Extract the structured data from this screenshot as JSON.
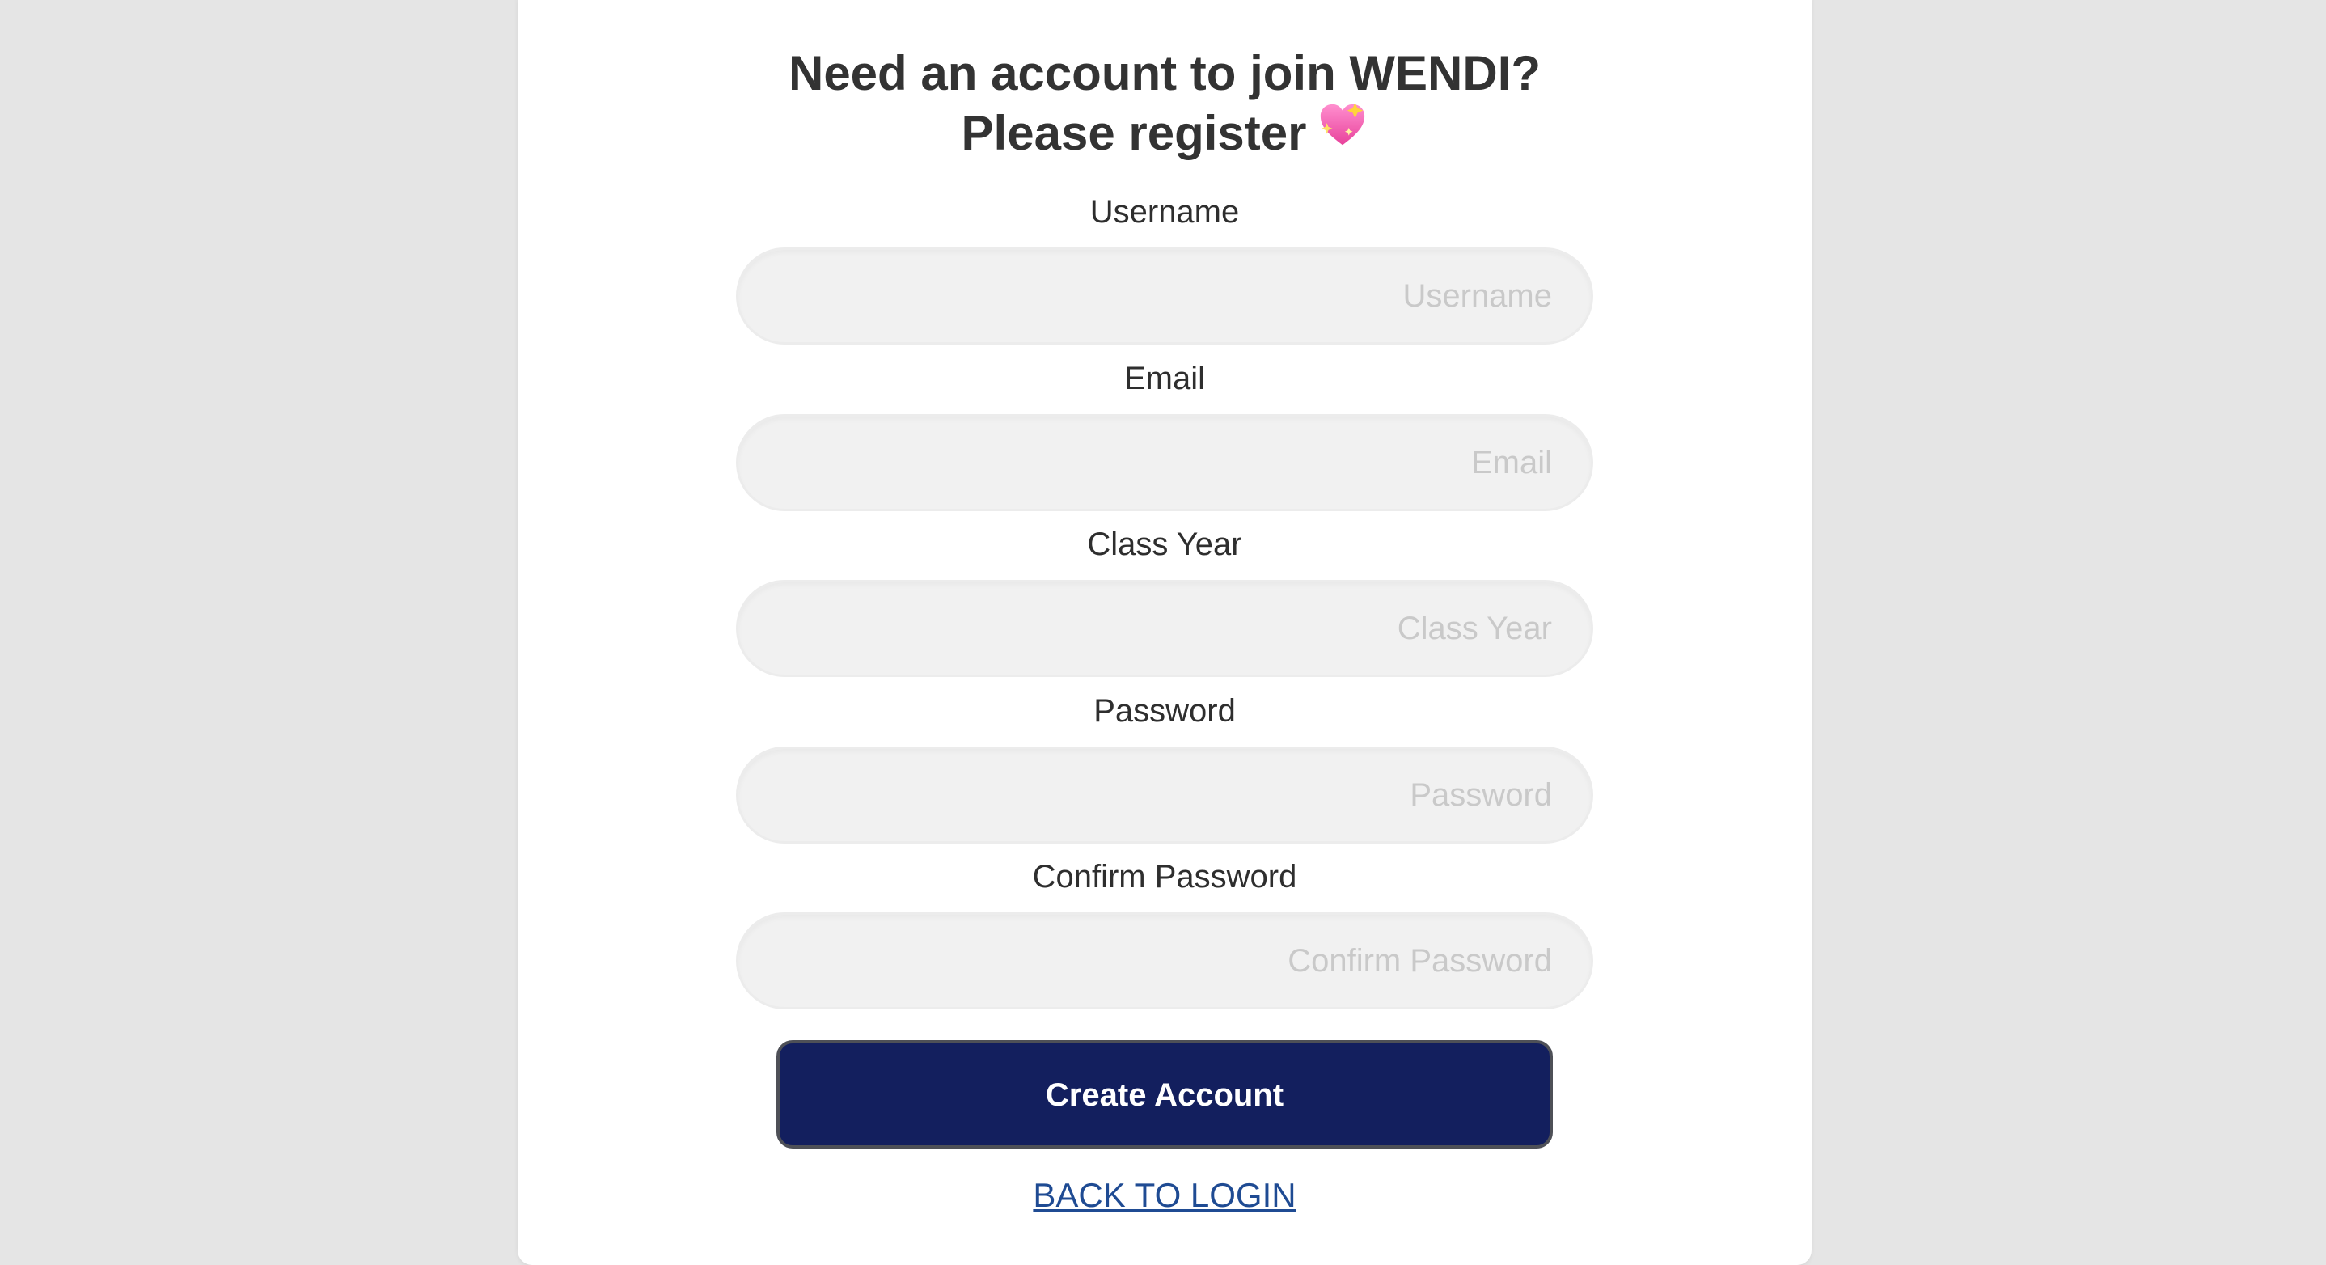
{
  "header": {
    "title_line1": "Need an account to join WENDI?",
    "title_line2": "Please register",
    "title_icon": "sparkling-heart-icon"
  },
  "form": {
    "username": {
      "label": "Username",
      "placeholder": "Username",
      "value": ""
    },
    "email": {
      "label": "Email",
      "placeholder": "Email",
      "value": ""
    },
    "class_year": {
      "label": "Class Year",
      "placeholder": "Class Year",
      "value": ""
    },
    "password": {
      "label": "Password",
      "placeholder": "Password",
      "value": ""
    },
    "confirm_password": {
      "label": "Confirm Password",
      "placeholder": "Confirm Password",
      "value": ""
    }
  },
  "actions": {
    "create_label": "Create Account",
    "back_label": "BACK TO LOGIN"
  },
  "colors": {
    "page_background": "#e5e5e5",
    "card_background": "#ffffff",
    "button_background": "#131f5e",
    "link": "#1f4b93",
    "input_background": "#f1f1f1"
  }
}
